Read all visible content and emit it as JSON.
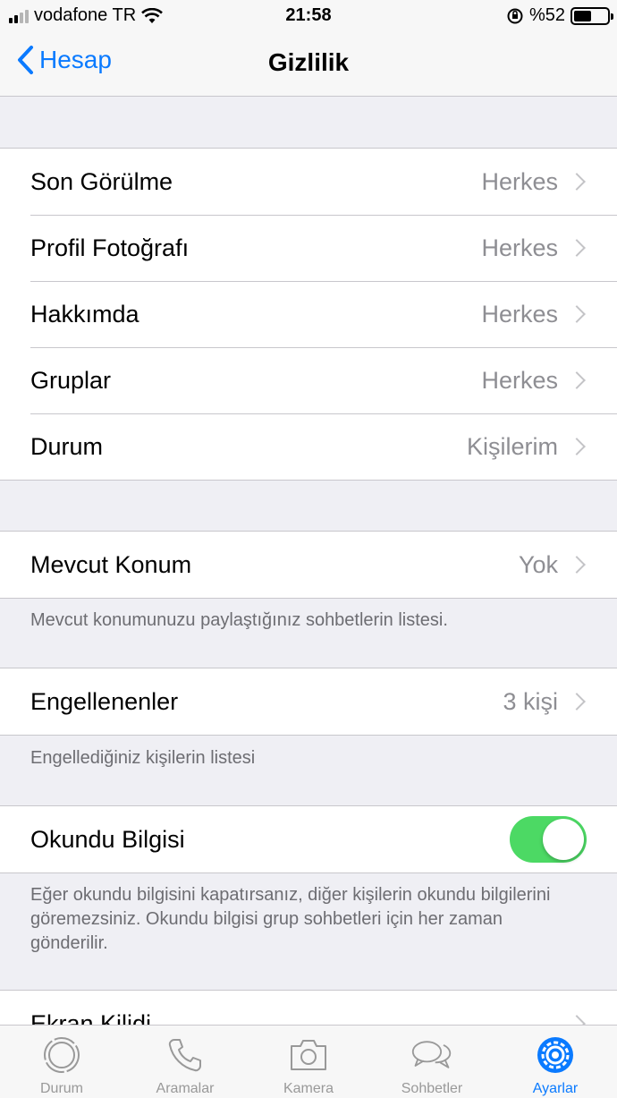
{
  "status_bar": {
    "carrier": "vodafone TR",
    "time": "21:58",
    "battery": "%52",
    "battery_level": 0.52
  },
  "nav": {
    "back_label": "Hesap",
    "title": "Gizlilik"
  },
  "privacy_items": [
    {
      "label": "Son Görülme",
      "value": "Herkes"
    },
    {
      "label": "Profil Fotoğrafı",
      "value": "Herkes"
    },
    {
      "label": "Hakkımda",
      "value": "Herkes"
    },
    {
      "label": "Gruplar",
      "value": "Herkes"
    },
    {
      "label": "Durum",
      "value": "Kişilerim"
    }
  ],
  "live_location": {
    "label": "Mevcut Konum",
    "value": "Yok",
    "note": "Mevcut konumunuzu paylaştığınız sohbetlerin listesi."
  },
  "blocked": {
    "label": "Engellenenler",
    "value": "3 kişi",
    "note": "Engellediğiniz kişilerin listesi"
  },
  "read_receipts": {
    "label": "Okundu Bilgisi",
    "enabled": true,
    "note": "Eğer okundu bilgisini kapatırsanız, diğer kişilerin okundu bilgilerini göremezsiniz. Okundu bilgisi grup sohbetleri için her zaman gönderilir."
  },
  "screen_lock": {
    "label": "Ekran Kilidi"
  },
  "tabs": [
    {
      "label": "Durum",
      "icon": "status-icon",
      "active": false
    },
    {
      "label": "Aramalar",
      "icon": "phone-icon",
      "active": false
    },
    {
      "label": "Kamera",
      "icon": "camera-icon",
      "active": false
    },
    {
      "label": "Sohbetler",
      "icon": "chat-icon",
      "active": false
    },
    {
      "label": "Ayarlar",
      "icon": "gear-icon",
      "active": true
    }
  ],
  "colors": {
    "accent": "#0a7aff",
    "toggle_on": "#4cd964",
    "background": "#efeff4"
  }
}
